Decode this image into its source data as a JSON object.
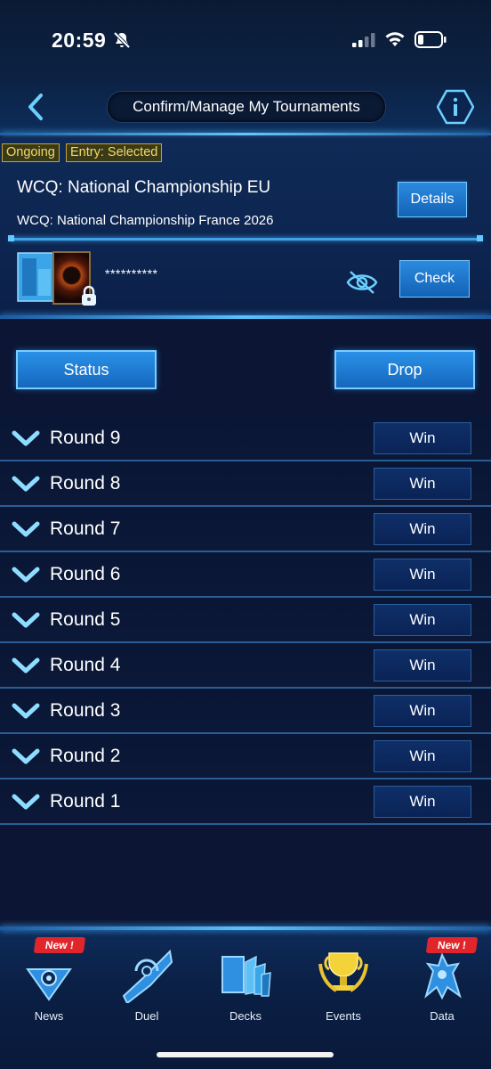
{
  "status_bar": {
    "time": "20:59"
  },
  "header": {
    "title": "Confirm/Manage My Tournaments"
  },
  "tournament": {
    "tags": [
      "Ongoing",
      "Entry: Selected"
    ],
    "name": "WCQ: National Championship EU",
    "subtitle": "WCQ: National Championship France 2026",
    "details_label": "Details",
    "code": "**********",
    "check_label": "Check"
  },
  "actions": {
    "status_label": "Status",
    "drop_label": "Drop"
  },
  "rounds": [
    {
      "label": "Round 9",
      "result": "Win"
    },
    {
      "label": "Round 8",
      "result": "Win"
    },
    {
      "label": "Round 7",
      "result": "Win"
    },
    {
      "label": "Round 6",
      "result": "Win"
    },
    {
      "label": "Round 5",
      "result": "Win"
    },
    {
      "label": "Round 4",
      "result": "Win"
    },
    {
      "label": "Round 3",
      "result": "Win"
    },
    {
      "label": "Round 2",
      "result": "Win"
    },
    {
      "label": "Round 1",
      "result": "Win"
    }
  ],
  "nav": {
    "items": [
      {
        "label": "News",
        "badge": "New !",
        "icon": "news-icon"
      },
      {
        "label": "Duel",
        "badge": "",
        "icon": "duel-icon"
      },
      {
        "label": "Decks",
        "badge": "",
        "icon": "decks-icon"
      },
      {
        "label": "Events",
        "badge": "",
        "icon": "events-icon"
      },
      {
        "label": "Data",
        "badge": "New !",
        "icon": "data-icon"
      }
    ]
  },
  "colors": {
    "accent": "#58c3ff",
    "button": "#1567bd",
    "tag": "#f2d86a"
  }
}
